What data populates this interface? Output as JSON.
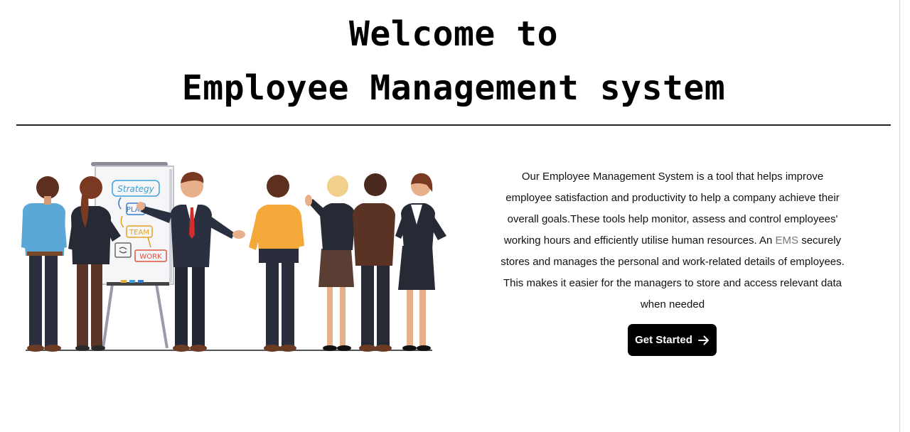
{
  "header": {
    "title_line1": "Welcome to",
    "title_line2": "Employee Management system"
  },
  "illustration": {
    "board_words": [
      "Strategy",
      "PLAN",
      "TEAM",
      "WORK"
    ]
  },
  "content": {
    "description_before": "Our Employee Management System is a tool that helps improve employee satisfaction and productivity to help a company achieve their overall goals.These tools help monitor, assess and control employees' working hours and efficiently utilise human resources. An ",
    "ems_term": "EMS",
    "description_after": " securely stores and manages the personal and work-related details of employees. This makes it easier for the managers to store and access relevant data when needed",
    "button_label": "Get Started",
    "button_icon": "arrow-right-icon"
  },
  "colors": {
    "button_bg": "#000000",
    "ems_term": "#777777"
  }
}
